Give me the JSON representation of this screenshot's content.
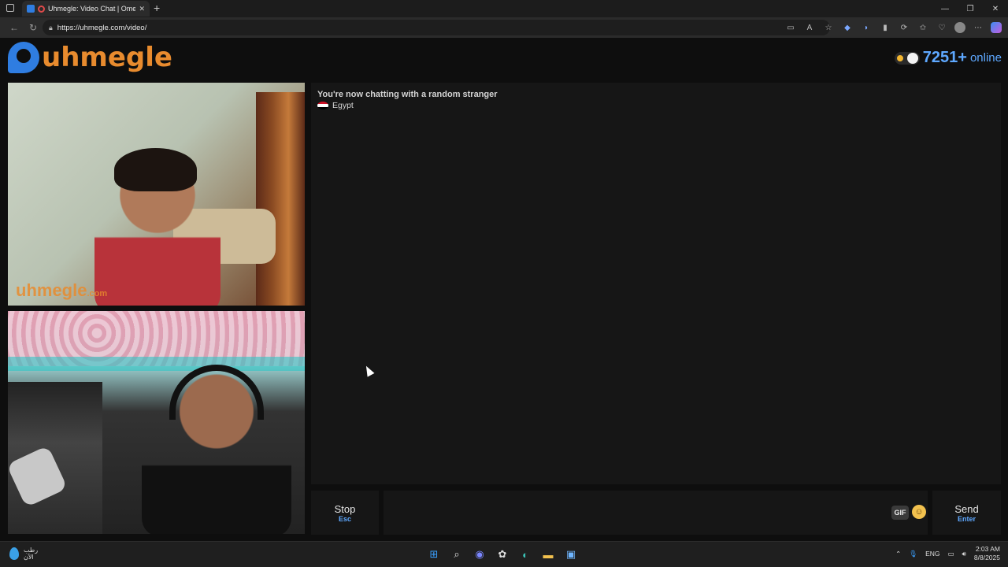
{
  "browser": {
    "tab_title": "Uhmegle: Video Chat | Ome...",
    "url": "https://uhmegle.com/video/",
    "window": {
      "minimize": "—",
      "restore": "❐",
      "close": "✕"
    }
  },
  "site": {
    "logo_text": "uhmegle",
    "online_count": "7251+",
    "online_label": "online",
    "video_watermark": "uhmegle",
    "video_watermark_suffix": ".com"
  },
  "chat": {
    "status_text": "You're now chatting with a random stranger",
    "country": "Egypt"
  },
  "controls": {
    "stop_label": "Stop",
    "stop_hint": "Esc",
    "send_label": "Send",
    "send_hint": "Enter",
    "gif_label": "GIF",
    "message_placeholder": ""
  },
  "taskbar": {
    "weather_line1": "رطب",
    "weather_line2": "الآن",
    "language": "ENG",
    "time": "2:03 AM",
    "date": "8/8/2025"
  },
  "colors": {
    "accent_blue": "#5ea8ff",
    "logo_orange": "#e88b2e",
    "panel_bg": "#161616"
  }
}
